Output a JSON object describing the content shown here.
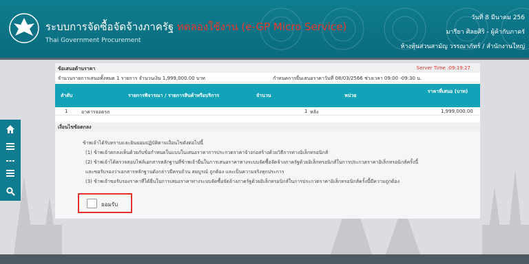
{
  "header": {
    "title": "ระบบการจัดซื้อจัดจ้างภาครัฐ",
    "env_label": "ทดลองใช้งาน (e-GP Micro Service)",
    "subtitle": "Thai Government Procurement",
    "date": "วันที่ 8 มีนาคม 256",
    "user": "มารียา ศิลยศิริ - ผู้ค้ากับภาครั",
    "org": "ห้างหุ้นส่วนสามัญ วรรณาภัทร์ / สำนักงานใหญ่"
  },
  "panel": {
    "section_title": "ข้อเสนอด้านราคา",
    "server_time": "Server Time :09:19:27",
    "summary": "จำนวนรายการเสนอทั้งหมด 1 รายการ จำนวนเงิน 1,999,000.00 บาท",
    "deadline": "กำหนดการยื่นเสนอราคาวันที่ 08/03/2566 ช่วงเวลา 09:00 -09:30 น.",
    "columns": [
      "ลำดับ",
      "รายการพิจารณา / รายการสินค้าหรือบริการ",
      "จำนวน",
      "หน่วย",
      "ราคาที่เสนอ (บาท)"
    ],
    "rows": [
      {
        "no": "1",
        "item": "อาคารจอดรถ",
        "qty": "1",
        "unit": "หลัง",
        "price": "1,999,000.00"
      }
    ],
    "conditions_title": "เงื่อนไขข้อตกลง",
    "conditions": [
      "ข้าพเจ้าได้รับทราบและยินยอมปฏิบัติตามเงื่อนไขดังต่อไปนี้",
      "(1) ข้าพเจ้าตกลงเห็นด้วยกับข้อกำหนดในแบบในเสนอราคาการประกวดราคาจ้างก่อสร้างด้วยวิธีการทางอิเล็กทรอนิกส์",
      "(2) ข้าพเจ้าได้ตรวจสอบไฟล์เอกสารหลักฐานที่ข้าพเจ้ายื่นในการเสนอราคาทางระบบจัดซื้อจัดจ้างภาครัฐด้วยอิเล็กทรอนิกส์ในการประกวดราคาอิเล็กทรอนิกส์ครั้งนี้",
      "และขอรับรองว่าเอกสารหลักฐานดังกล่าวมีครบถ้วน สมบูรณ์ ถูกต้อง และเป็นความจริงทุกประการ",
      "(3) ข้าพเจ้าขอรับรองราคาที่ได้ยื่นในการเสนอราคาทางระบบจัดซื้อจัดจ้างภาครัฐด้วยอิเล็กทรอนิกส์ในการประกวดราคาอิเล็กทรอนิกส์ครั้งนี้มีความถูกต้อง"
    ],
    "accept_label": "ยอมรับ"
  },
  "sidebar": {
    "icons": [
      "home-icon",
      "menu-icon",
      "collapse-icon",
      "list-icon",
      "search-icon"
    ]
  },
  "colors": {
    "header": "#0f7d8f",
    "table_header": "#13a3b8",
    "highlight": "#e8302a"
  }
}
